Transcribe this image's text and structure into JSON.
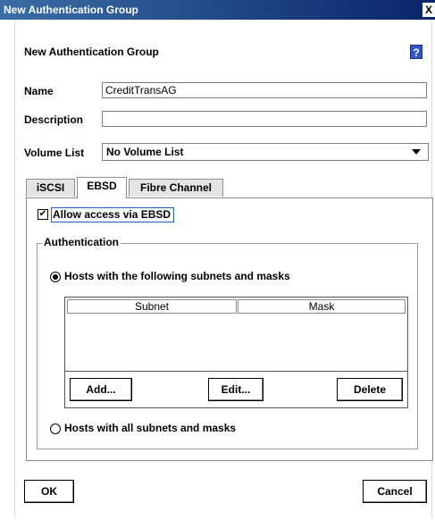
{
  "window": {
    "title": "New Authentication Group",
    "close_glyph": "X"
  },
  "dialog": {
    "heading": "New Authentication Group",
    "help_glyph": "?"
  },
  "form": {
    "name_label": "Name",
    "name_value": "CreditTransAG",
    "description_label": "Description",
    "description_value": "",
    "volume_list_label": "Volume List",
    "volume_list_value": "No Volume List"
  },
  "tabs": [
    {
      "label": "iSCSI",
      "active": false
    },
    {
      "label": "EBSD",
      "active": true
    },
    {
      "label": "Fibre Channel",
      "active": false
    }
  ],
  "ebsd": {
    "allow_access_label": "Allow access via EBSD",
    "allow_access_checked": true,
    "authentication_legend": "Authentication",
    "option_subnets_label": "Hosts with the following subnets and masks",
    "option_all_label": "Hosts with all subnets and masks",
    "selected_option": "subnets",
    "table": {
      "columns": [
        "Subnet",
        "Mask"
      ],
      "rows": []
    },
    "add_label": "Add...",
    "edit_label": "Edit...",
    "delete_label": "Delete"
  },
  "footer": {
    "ok_label": "OK",
    "cancel_label": "Cancel"
  },
  "colors": {
    "titlebar_start": "#3a6ea5",
    "titlebar_end": "#0a246a",
    "help_icon": "#3355cc"
  }
}
